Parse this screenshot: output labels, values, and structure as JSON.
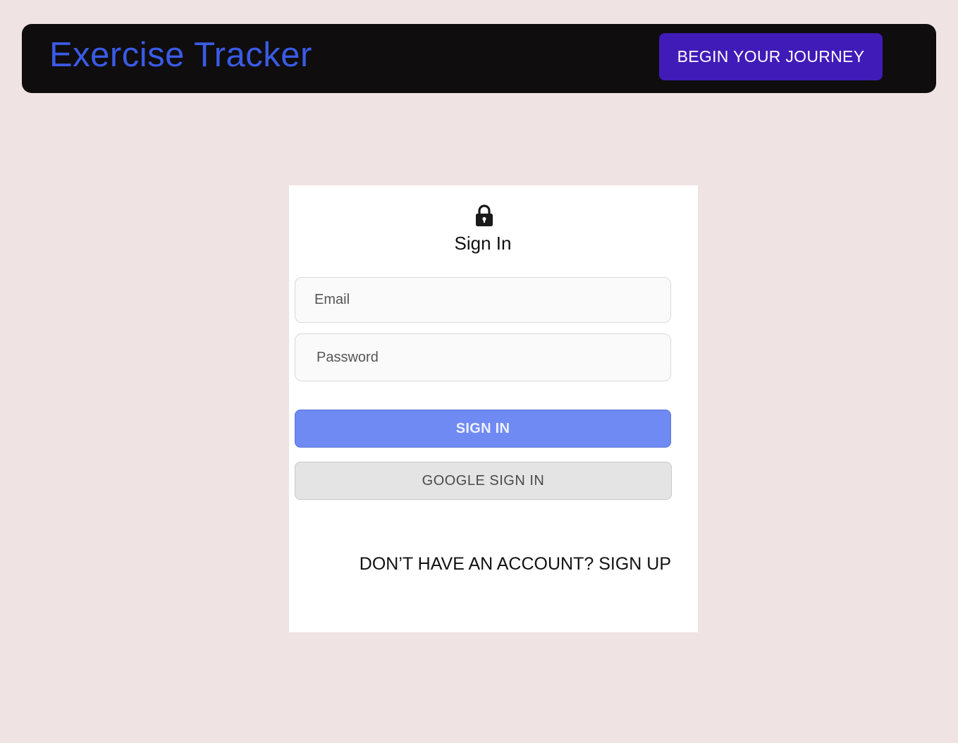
{
  "header": {
    "app_title": "Exercise Tracker",
    "cta_label": "BEGIN YOUR JOURNEY"
  },
  "signin": {
    "icon": "lock-icon",
    "title": "Sign In",
    "email_placeholder": "Email",
    "password_placeholder": "Password",
    "submit_label": "SIGN IN",
    "google_label": "GOOGLE SIGN IN",
    "signup_link": "DON’T HAVE AN ACCOUNT? SIGN UP"
  },
  "colors": {
    "page_background": "#efe3e3",
    "header_background": "#0f0d0d",
    "title_accent": "#3a5be6",
    "cta_background": "#411bb8",
    "signin_button": "#6f8af3",
    "google_button": "#e4e4e4"
  }
}
